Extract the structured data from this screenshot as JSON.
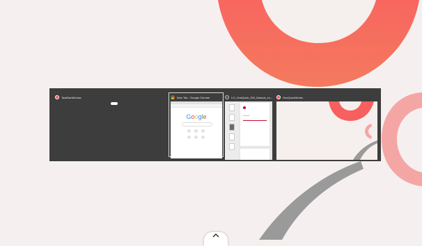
{
  "wallpaper": {
    "background": "#f5f0ef",
    "accent_colors": [
      "#f7605e",
      "#f4a3a2",
      "#9a9a9a"
    ]
  },
  "task_switcher": {
    "windows": [
      {
        "title": "TaskBarWindow",
        "icon": "app-icon",
        "active": false
      },
      {
        "title": "New Tab - Google Chrome",
        "icon": "chrome-icon",
        "active": true,
        "content": {
          "logo": "Google"
        }
      },
      {
        "title": "LG_OneQuick_EW_Manual_en...",
        "icon": "pdf-viewer-icon",
        "active": false,
        "content": {
          "page_title": "OneQuick"
        }
      },
      {
        "title": "OneQuickWorks",
        "icon": "app-icon",
        "active": false
      }
    ]
  },
  "dock_toggle": {
    "icon": "chevron-up-icon"
  }
}
